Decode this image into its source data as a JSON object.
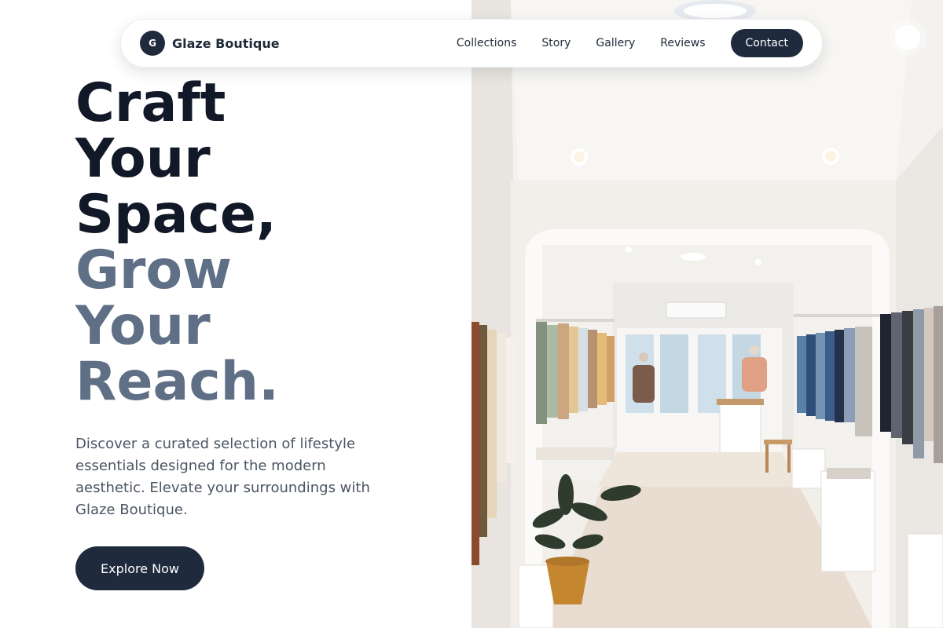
{
  "brand": {
    "initial": "G",
    "name": "Glaze Boutique"
  },
  "nav": {
    "links": [
      "Collections",
      "Story",
      "Gallery",
      "Reviews"
    ],
    "contact_label": "Contact"
  },
  "hero": {
    "headline_dark": [
      "Craft",
      "Your",
      "Space,"
    ],
    "headline_muted": [
      "Grow",
      "Your",
      "Reach."
    ],
    "description": "Discover a curated selection of lifestyle essentials designed for the modern aesthetic. Elevate your surroundings with Glaze Boutique.",
    "cta_label": "Explore Now"
  },
  "colors": {
    "primary": "#1f2a3d",
    "headline_dark": "#111827",
    "headline_muted": "#5f6f86",
    "body_text": "#4b5563"
  },
  "image": {
    "subject": "boutique-interior-photo"
  }
}
